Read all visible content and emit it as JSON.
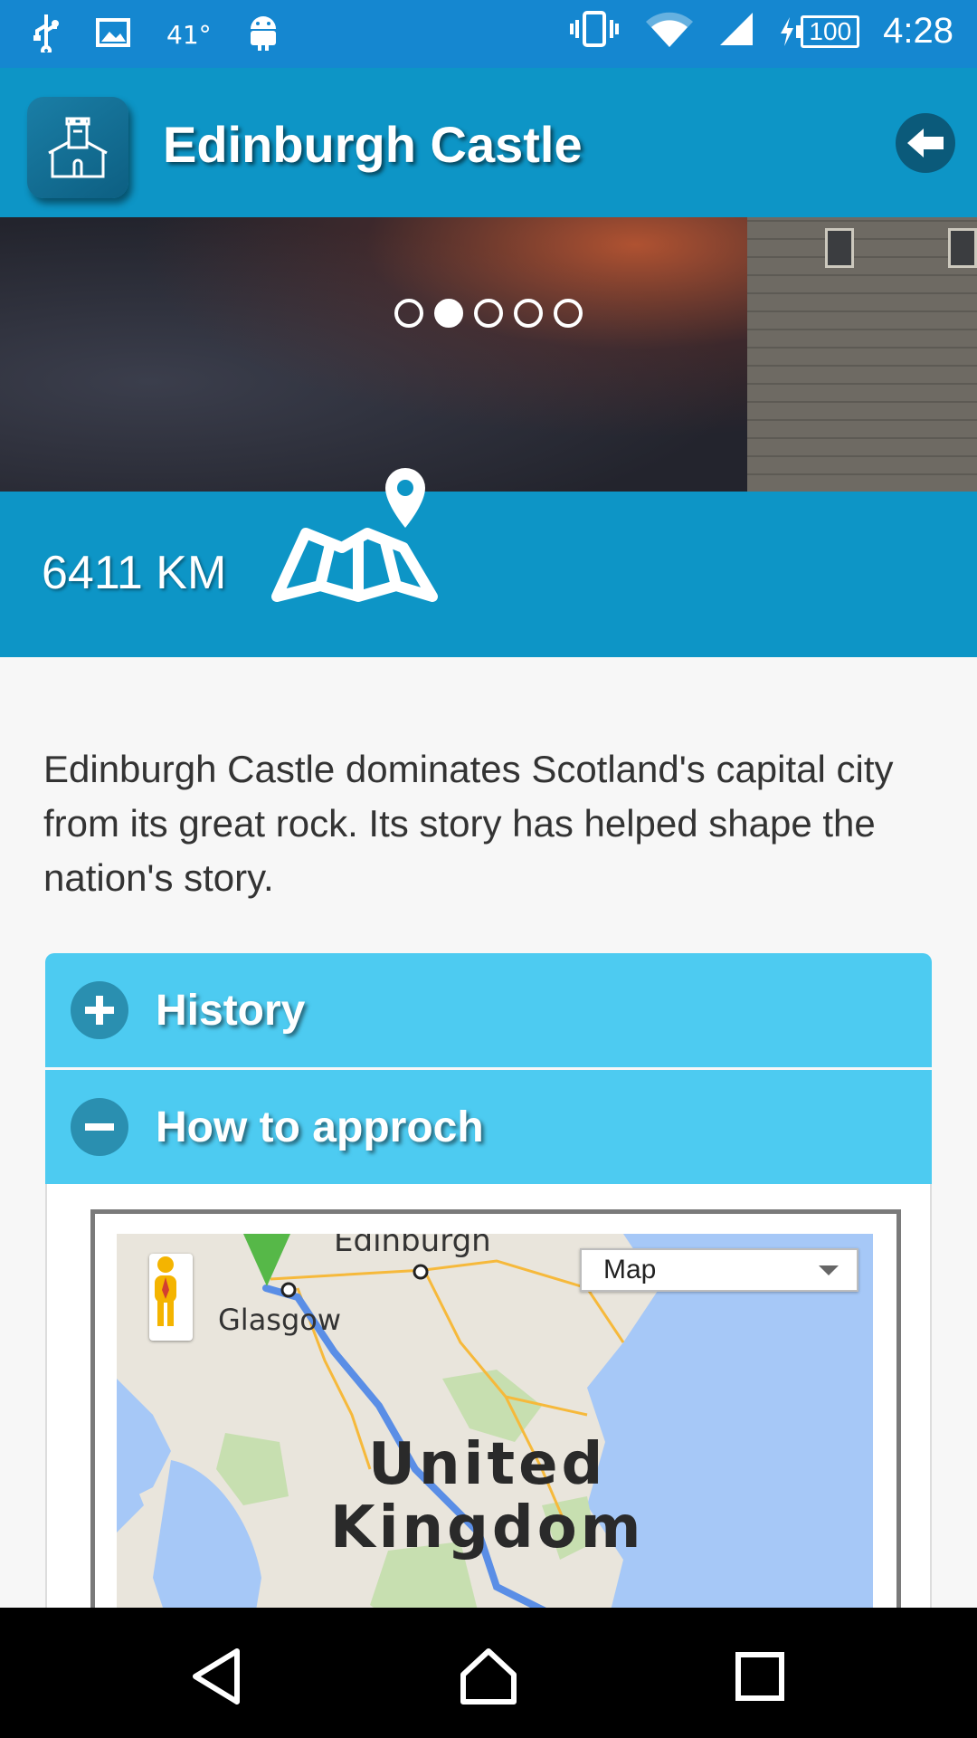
{
  "status_bar": {
    "temperature": "41°",
    "battery": "100",
    "time": "4:28",
    "icons": [
      "usb-icon",
      "image-icon",
      "android-icon",
      "vibrate-icon",
      "wifi-icon",
      "signal-icon",
      "charging-icon",
      "battery-icon"
    ]
  },
  "header": {
    "title": "Edinburgh Castle",
    "app_icon": "castle-icon",
    "back_icon": "back-arrow-icon"
  },
  "carousel": {
    "slide_count": 5,
    "active_index": 1
  },
  "distance": {
    "value": "6411 KM",
    "icon": "map-pin-icon"
  },
  "description": "Edinburgh Castle dominates Scotland's capital city from its great rock. Its story has helped shape the nation's story.",
  "accordion": [
    {
      "label": "History",
      "icon": "plus-icon",
      "expanded": false
    },
    {
      "label": "How to approch",
      "icon": "minus-icon",
      "expanded": true
    }
  ],
  "map": {
    "type_select": "Map",
    "labels": {
      "edinburgh": "Edinburgh",
      "glasgow": "Glasgow",
      "country_line1": "United",
      "country_line2": "Kingdom"
    }
  },
  "nav_bar": {
    "icons": [
      "back-triangle-icon",
      "home-icon",
      "recents-icon"
    ]
  },
  "colors": {
    "status_bar": "#1587d0",
    "action_bar": "#0d95c6",
    "accordion": "#4dcbf1",
    "accordion_icon": "#2a8fb0"
  }
}
